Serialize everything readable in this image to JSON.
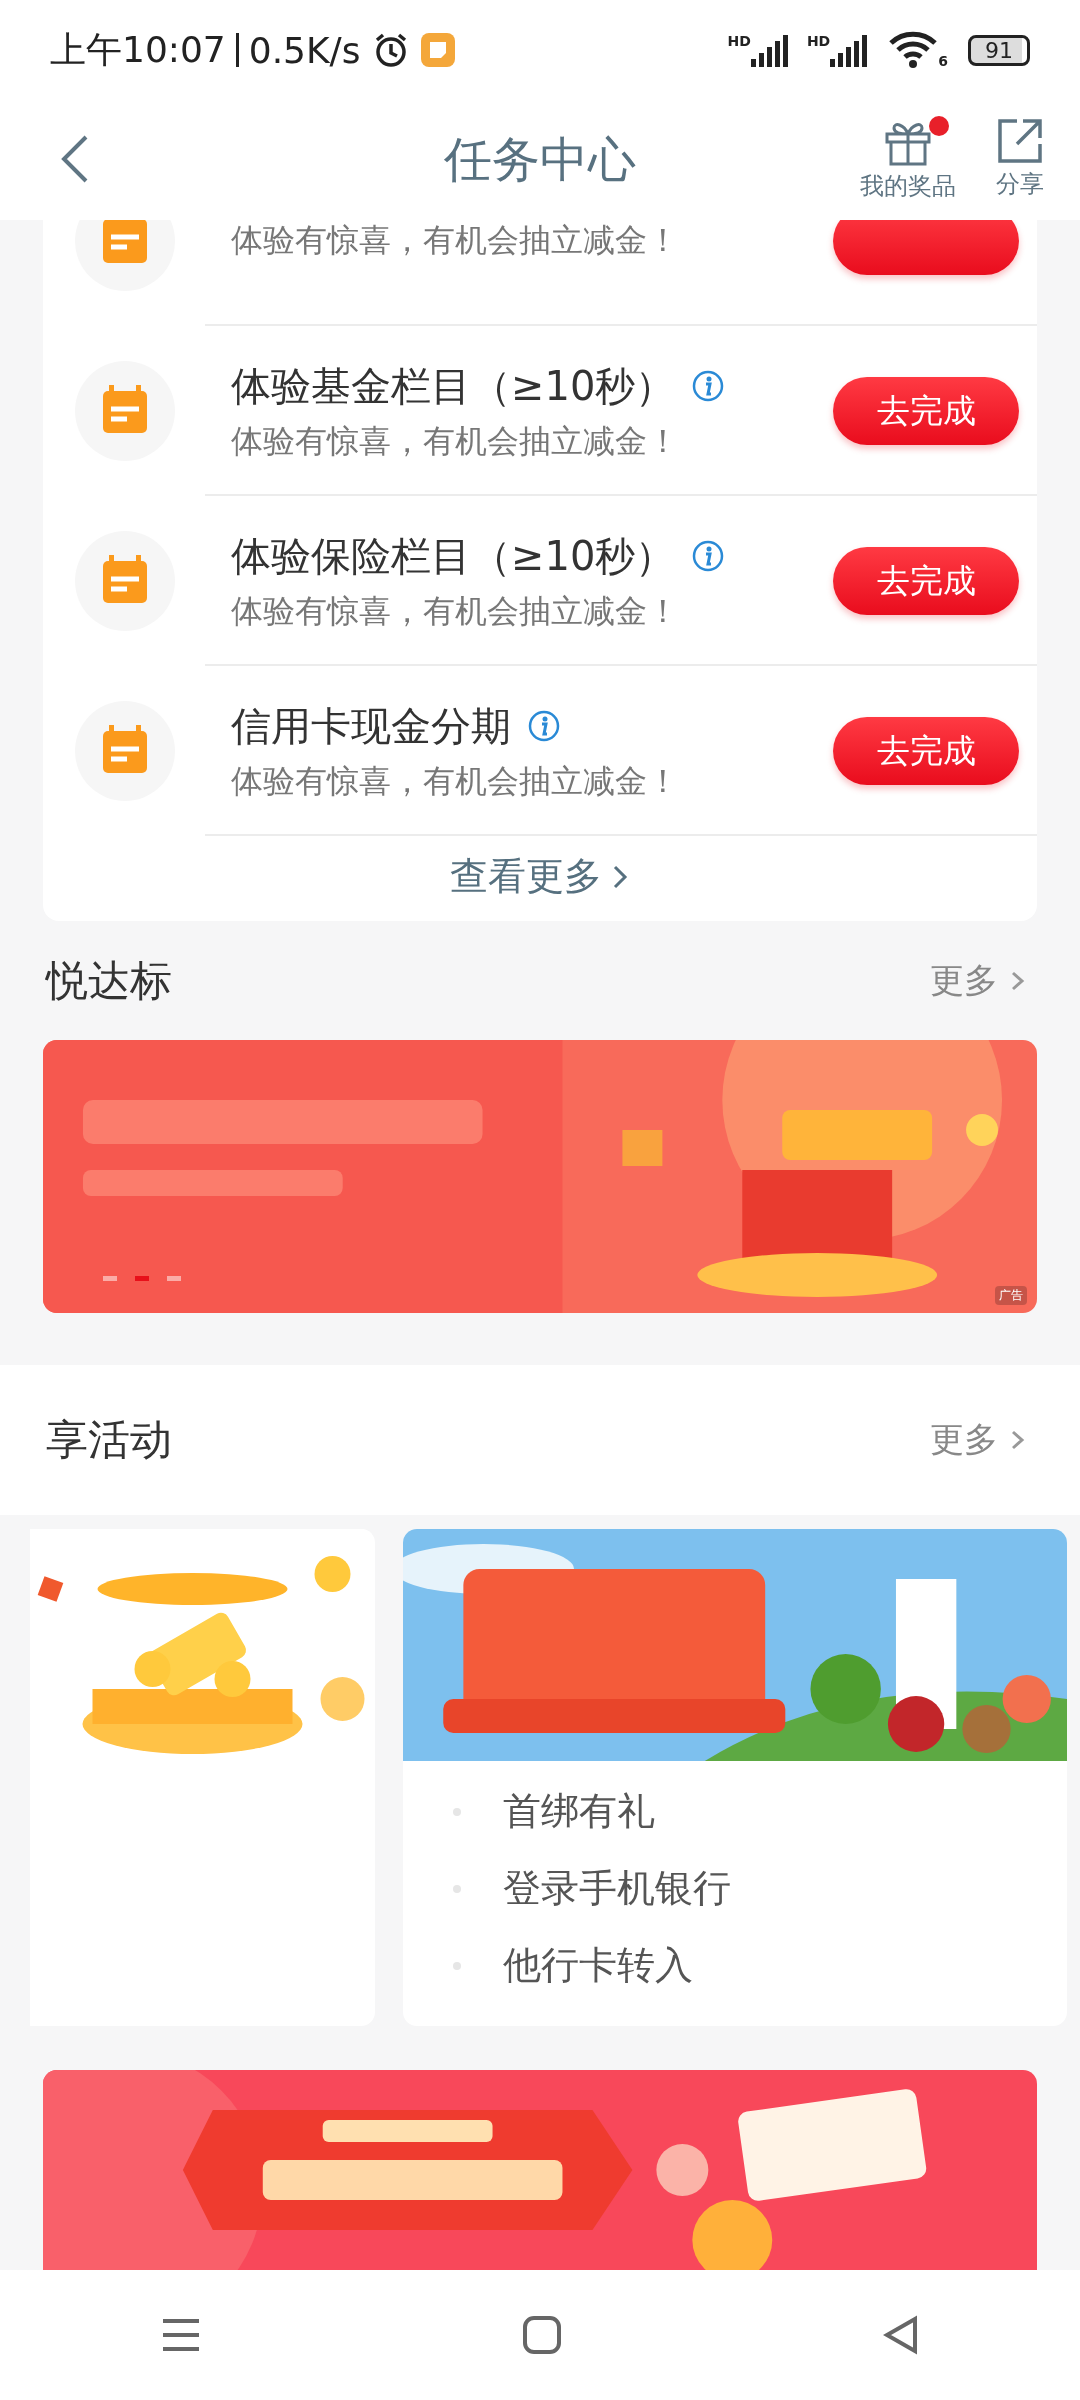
{
  "status_bar": {
    "time": "上午10:07",
    "speed": "0.5K/s",
    "signal_labels": [
      "HD",
      "HD"
    ],
    "wifi_label": "6",
    "battery": "91"
  },
  "header": {
    "title": "任务中心",
    "actions": [
      {
        "kind": "gift",
        "label": "我的奖品",
        "badge": true
      },
      {
        "kind": "share",
        "label": "分享",
        "badge": false
      }
    ]
  },
  "tasks": {
    "partial_subtitle": "体验有惊喜，有机会抽立减金！",
    "items": [
      {
        "title": "体验基金栏目（≥10秒）",
        "subtitle": "体验有惊喜，有机会抽立减金！",
        "button": "去完成"
      },
      {
        "title": "体验保险栏目（≥10秒）",
        "subtitle": "体验有惊喜，有机会抽立减金！",
        "button": "去完成"
      },
      {
        "title": "信用卡现金分期",
        "subtitle": "体验有惊喜，有机会抽立减金！",
        "button": "去完成"
      }
    ],
    "more": "查看更多"
  },
  "section_1": {
    "title": "悦达标",
    "more": "更多",
    "banner": {
      "kind": "picture",
      "ad_label": "广告",
      "pages": [
        {
          "selected": false
        },
        {
          "selected": true
        },
        {
          "selected": false
        }
      ]
    }
  },
  "section_2": {
    "title": "享活动",
    "more": "更多",
    "cards": [
      {
        "kind": "picture"
      },
      {
        "kind": "picture",
        "steps": [
          "首绑有礼",
          "登录手机银行",
          "他行卡转入"
        ]
      }
    ]
  },
  "bottom_banner": {
    "kind": "picture"
  },
  "nav_bar": [
    {
      "kind": "menu"
    },
    {
      "kind": "home"
    },
    {
      "kind": "back"
    }
  ]
}
